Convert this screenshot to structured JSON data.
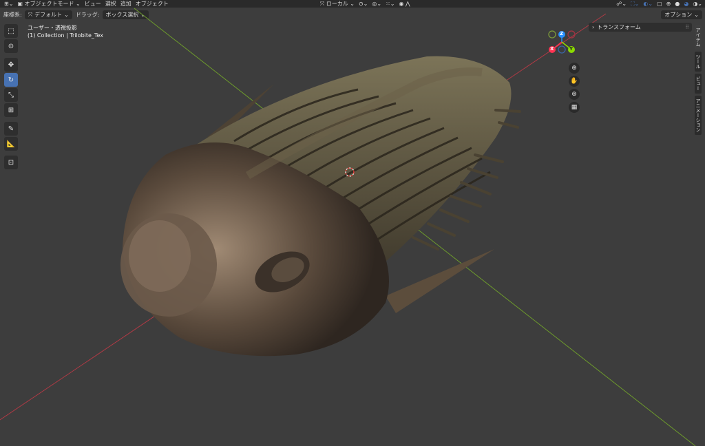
{
  "header": {
    "mode_label": "オブジェクトモード",
    "menu": [
      "ビュー",
      "選択",
      "追加",
      "オブジェクト"
    ],
    "pivot_label": "ローカル"
  },
  "subbar": {
    "orientation_label": "座標系:",
    "orientation_value": "デフォルト",
    "drag_label": "ドラッグ:",
    "drag_value": "ボックス選択",
    "options_label": "オプション"
  },
  "viewport": {
    "view_name": "ユーザー・透視投影",
    "collection_info": "(1) Collection | Trilobite_Tex"
  },
  "gizmo": {
    "z": "Z",
    "x": "X",
    "y": "Y"
  },
  "npanel": {
    "section": "トランスフォーム",
    "tabs": [
      "アイテム",
      "ツール",
      "ビュー",
      "アニメーション"
    ]
  },
  "colors": {
    "accent": "#4772b3",
    "x_axis": "#ff3352",
    "y_axis": "#8bdc00",
    "z_axis": "#2890ff",
    "bg": "#3d3d3d"
  }
}
